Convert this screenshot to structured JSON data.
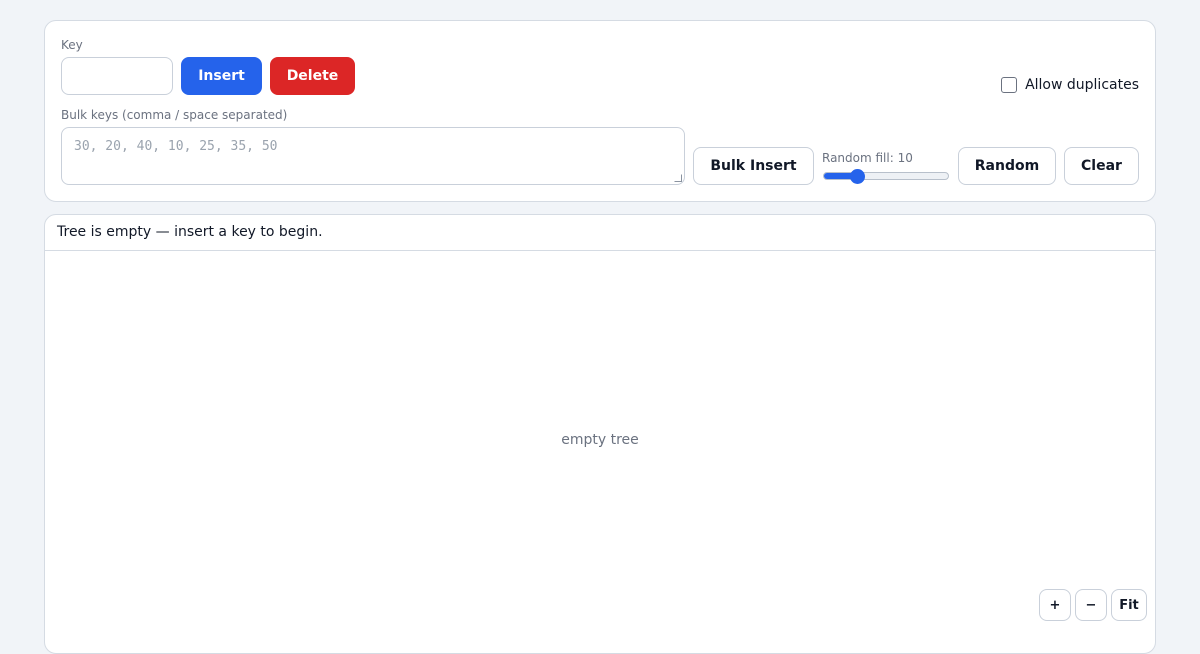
{
  "controls": {
    "key_label": "Key",
    "key_value": "",
    "insert_label": "Insert",
    "delete_label": "Delete",
    "allow_duplicates_label": "Allow duplicates",
    "allow_duplicates_checked": false,
    "bulk_label": "Bulk keys (comma / space separated)",
    "bulk_placeholder": "30, 20, 40, 10, 25, 35, 50",
    "bulk_insert_label": "Bulk Insert",
    "random_fill_label": "Random fill: 10",
    "random_fill_fraction": 0.27,
    "random_label": "Random",
    "clear_label": "Clear"
  },
  "tree": {
    "status": "Tree is empty — insert a key to begin.",
    "empty_message": "empty tree"
  },
  "zoom": {
    "zoom_in": "+",
    "zoom_out": "−",
    "fit": "Fit"
  },
  "colors": {
    "accent": "#2563eb",
    "danger": "#dc2626"
  }
}
